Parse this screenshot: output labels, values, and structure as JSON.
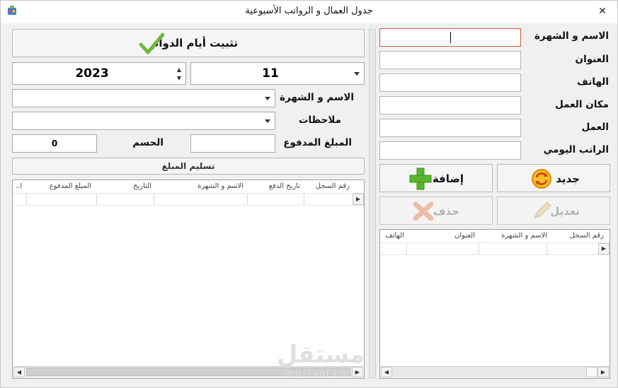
{
  "window": {
    "title": "جدول العمال و الرواتب الأسبوعية",
    "close_glyph": "✕"
  },
  "employee_form": {
    "fields": [
      {
        "label": "الاسم و الشهرة",
        "value": ""
      },
      {
        "label": "العنوان",
        "value": ""
      },
      {
        "label": "الهاتف",
        "value": ""
      },
      {
        "label": "مكان العمل",
        "value": ""
      },
      {
        "label": "العمل",
        "value": ""
      },
      {
        "label": "الراتب اليومي",
        "value": ""
      }
    ],
    "buttons": {
      "new": "جديد",
      "add": "إضافة",
      "edit": "تعديل",
      "delete": "حذف"
    }
  },
  "employees_grid": {
    "columns": [
      "رقم السجل",
      "الاسم و الشهرة",
      "العنوان",
      "الهاتف"
    ]
  },
  "attendance": {
    "confirm_button": "تثبيت أيام الدوام",
    "month": "11",
    "year": "2023",
    "name_label": "الاسم و الشهرة",
    "notes_label": "ملاحظات",
    "paid_label": "المبلغ المدفوع",
    "paid_value": "",
    "discount_label": "الحسم",
    "discount_value": "0",
    "deliver_button": "تسليم المبلغ"
  },
  "payments_grid": {
    "columns": [
      "رقم السجل",
      "تاريخ الدفع",
      "الاسم و الشهرة",
      "التاريخ",
      "المبلغ المدفوع",
      "ا.."
    ]
  },
  "watermark": {
    "main": "مستقل",
    "sub": "mostaql.com"
  },
  "colors": {
    "accent_focus": "#d2593a",
    "add_green": "#5ab52e",
    "new_orange": "#f0a30a",
    "disabled_icon": "#e8a88a"
  }
}
